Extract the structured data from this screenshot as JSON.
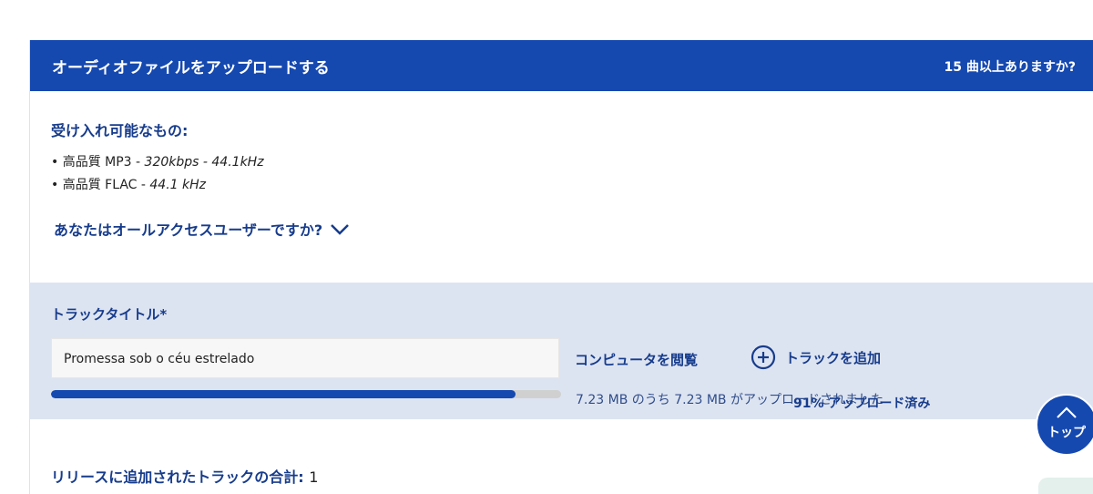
{
  "header": {
    "title": "オーディオファイルをアップロードする",
    "more_songs_link": "15 曲以上ありますか?"
  },
  "accepted": {
    "title": "受け入れ可能なもの:",
    "formats": [
      {
        "bullet": "• 高品質 MP3 - ",
        "detail": "320kbps - 44.1kHz"
      },
      {
        "bullet": "• 高品質 FLAC - ",
        "detail": "44.1 kHz"
      }
    ]
  },
  "all_access": {
    "question": "あなたはオールアクセスユーザーですか?",
    "icon": "chevron-down-icon"
  },
  "track": {
    "label": "トラックタイトル*",
    "title_value": "Promessa sob o céu estrelado",
    "browse_label": "コンピュータを閲覧",
    "add_track_label": "トラックを追加",
    "add_icon": "plus-circle-icon",
    "upload_size_text": "7.23 MB のうち 7.23 MB がアップロードされました",
    "upload_status_text": "91% アップロード済み",
    "progress_fraction": 0.91
  },
  "summary": {
    "total_label": "リリースに追加されたトラックの合計:",
    "total_count": "1"
  },
  "back_to_top": {
    "label": "トップ",
    "icon": "chevron-up-icon"
  },
  "colors": {
    "brand_blue": "#1549b0",
    "heading_blue": "#173c8c",
    "track_bg": "#dde4f1"
  }
}
